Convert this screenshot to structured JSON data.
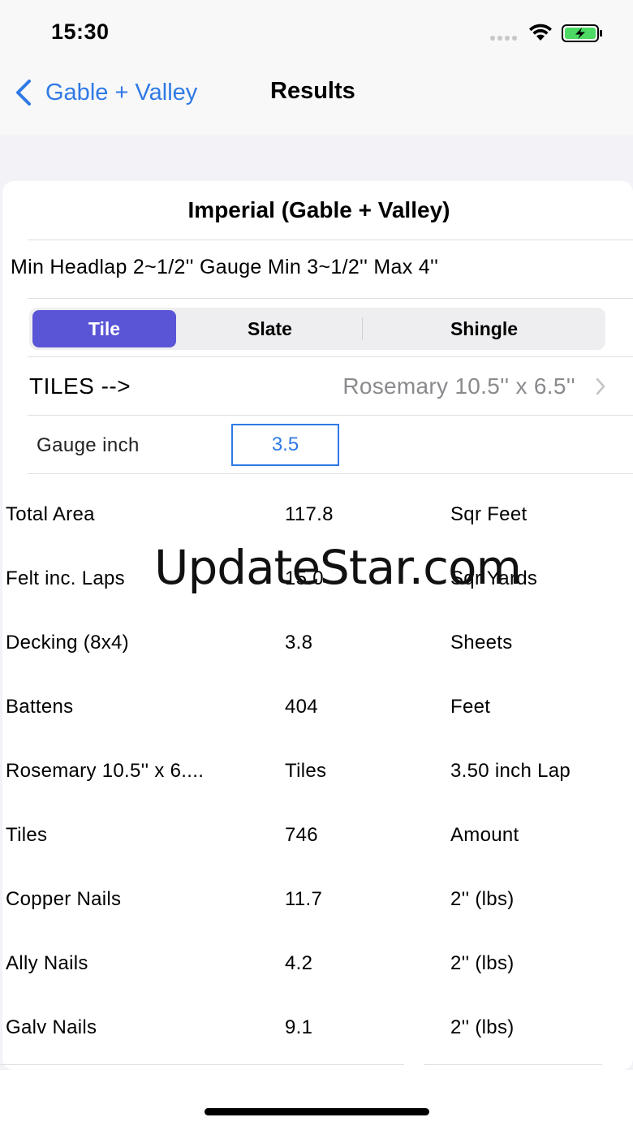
{
  "status_bar": {
    "time": "15:30"
  },
  "nav": {
    "back_label": "Gable + Valley",
    "title": "Results"
  },
  "card": {
    "title": "Imperial (Gable + Valley)",
    "spec_line": "Min Headlap 2~1/2'' Gauge Min 3~1/2'' Max 4''"
  },
  "segments": [
    {
      "label": "Tile",
      "selected": true
    },
    {
      "label": "Slate",
      "selected": false
    },
    {
      "label": "Shingle",
      "selected": false
    }
  ],
  "tiles_row": {
    "label": "TILES -->",
    "value": "Rosemary 10.5'' x 6.5''"
  },
  "gauge": {
    "label": "Gauge inch",
    "value": "3.5"
  },
  "results": [
    {
      "name": "Total Area",
      "value": "117.8",
      "unit": "Sqr Feet"
    },
    {
      "name": "Felt inc. Laps",
      "value": "15.0",
      "unit": "Sqr Yards"
    },
    {
      "name": "Decking (8x4)",
      "value": "3.8",
      "unit": "Sheets"
    },
    {
      "name": "Battens",
      "value": "404",
      "unit": "Feet"
    },
    {
      "name": "Rosemary 10.5'' x 6....",
      "value": "Tiles",
      "unit": "3.50 inch Lap"
    },
    {
      "name": "Tiles",
      "value": "746",
      "unit": "Amount"
    },
    {
      "name": "Copper Nails",
      "value": "11.7",
      "unit": "2'' (lbs)"
    },
    {
      "name": "Ally Nails",
      "value": "4.2",
      "unit": "2'' (lbs)"
    },
    {
      "name": "Galv Nails",
      "value": "9.1",
      "unit": "2'' (lbs)"
    }
  ],
  "watermark": "UpdateStar.com",
  "colors": {
    "accent": "#2f7ae5",
    "segment_selected": "#5a55d6",
    "battery": "#4cd964"
  }
}
